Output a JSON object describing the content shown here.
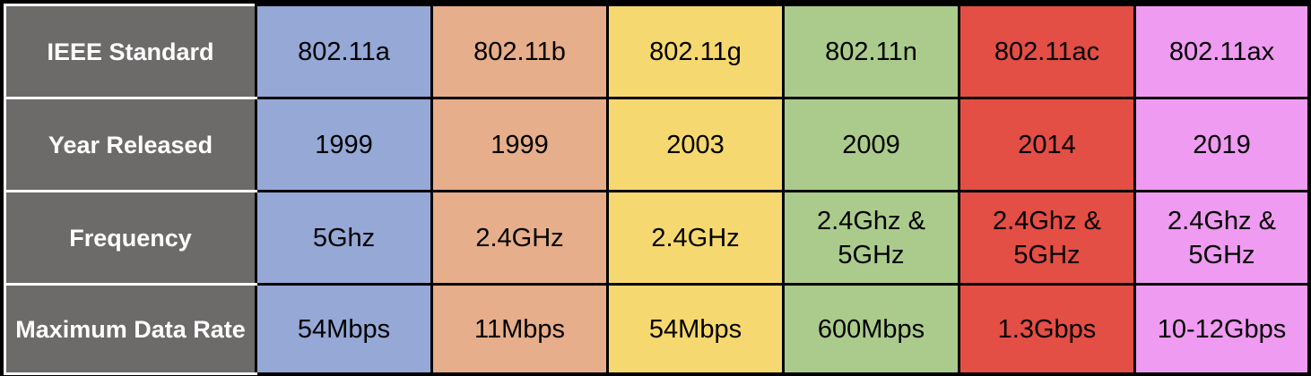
{
  "table": {
    "row_headers": [
      "IEEE Standard",
      "Year Released",
      "Frequency",
      "Maximum Data Rate"
    ],
    "columns": [
      {
        "color": "#95a8d6",
        "standard": "802.11a",
        "year": "1999",
        "frequency": [
          "5Ghz"
        ],
        "max_rate": "54Mbps"
      },
      {
        "color": "#e6ae8a",
        "standard": "802.11b",
        "year": "1999",
        "frequency": [
          "2.4GHz"
        ],
        "max_rate": "11Mbps"
      },
      {
        "color": "#f6d870",
        "standard": "802.11g",
        "year": "2003",
        "frequency": [
          "2.4GHz"
        ],
        "max_rate": "54Mbps"
      },
      {
        "color": "#abcb8c",
        "standard": "802.11n",
        "year": "2009",
        "frequency": [
          "2.4Ghz &",
          "5GHz"
        ],
        "max_rate": "600Mbps"
      },
      {
        "color": "#e34e45",
        "standard": "802.11ac",
        "year": "2014",
        "frequency": [
          "2.4Ghz &",
          "5GHz"
        ],
        "max_rate": "1.3Gbps"
      },
      {
        "color": "#ef9bf1",
        "standard": "802.11ax",
        "year": "2019",
        "frequency": [
          "2.4Ghz &",
          "5GHz"
        ],
        "max_rate": "10-12Gbps"
      }
    ]
  }
}
